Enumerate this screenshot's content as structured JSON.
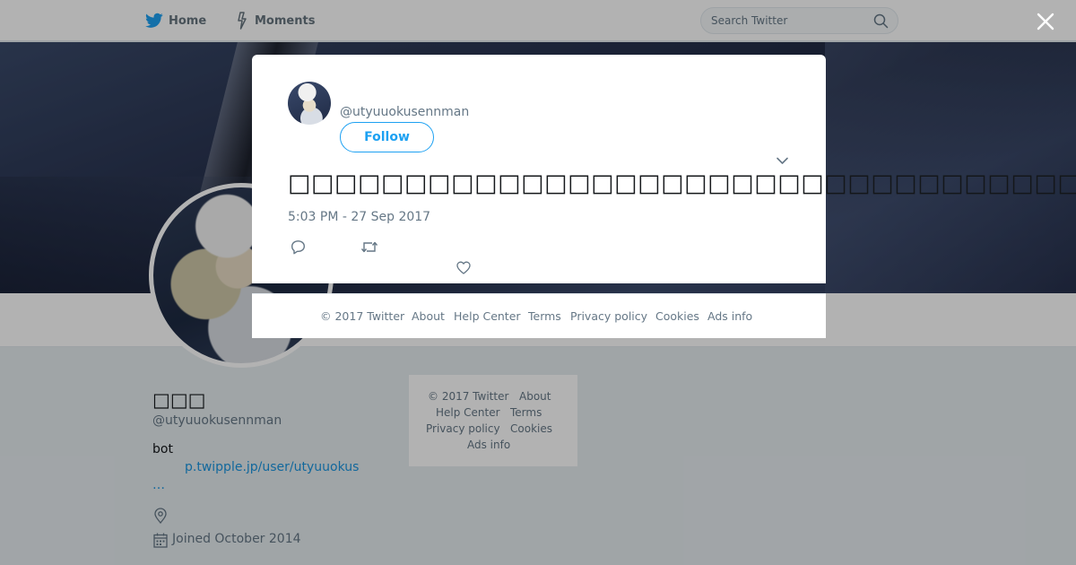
{
  "nav": {
    "home_label": "Home",
    "moments_label": "Moments",
    "search_placeholder": "Search Twitter",
    "brand_color": "#1da1f2"
  },
  "profile": {
    "name": "□□□",
    "handle": "@utyuuokusennman",
    "bio": "bot",
    "link": "p.twipple.jp/user/utyuuokus",
    "link_more": "…",
    "joined": "Joined October 2014"
  },
  "side_footer": {
    "copyright": "© 2017 Twitter",
    "about": "About",
    "help": "Help Center",
    "terms": "Terms",
    "privacy": "Privacy policy",
    "cookies": "Cookies",
    "ads": "Ads info"
  },
  "tweet": {
    "handle": "@utyuuokusennman",
    "follow_label": "Follow",
    "text": "□□□□□□□□□□□□□□□□□□□□□□□□□□□□□□□□□□",
    "timestamp": "5:03 PM - 27 Sep 2017"
  },
  "modal_footer": {
    "copyright": "© 2017 Twitter",
    "about": "About",
    "help": "Help Center",
    "terms": "Terms",
    "privacy": "Privacy policy",
    "cookies": "Cookies",
    "ads": "Ads info"
  },
  "icons": {
    "twitter": "twitter-bird-icon",
    "moments": "lightning-icon",
    "search": "search-icon",
    "close": "close-icon",
    "chevron": "chevron-down-icon",
    "reply": "reply-icon",
    "retweet": "retweet-icon",
    "like": "heart-icon",
    "location": "location-pin-icon",
    "calendar": "calendar-icon"
  }
}
